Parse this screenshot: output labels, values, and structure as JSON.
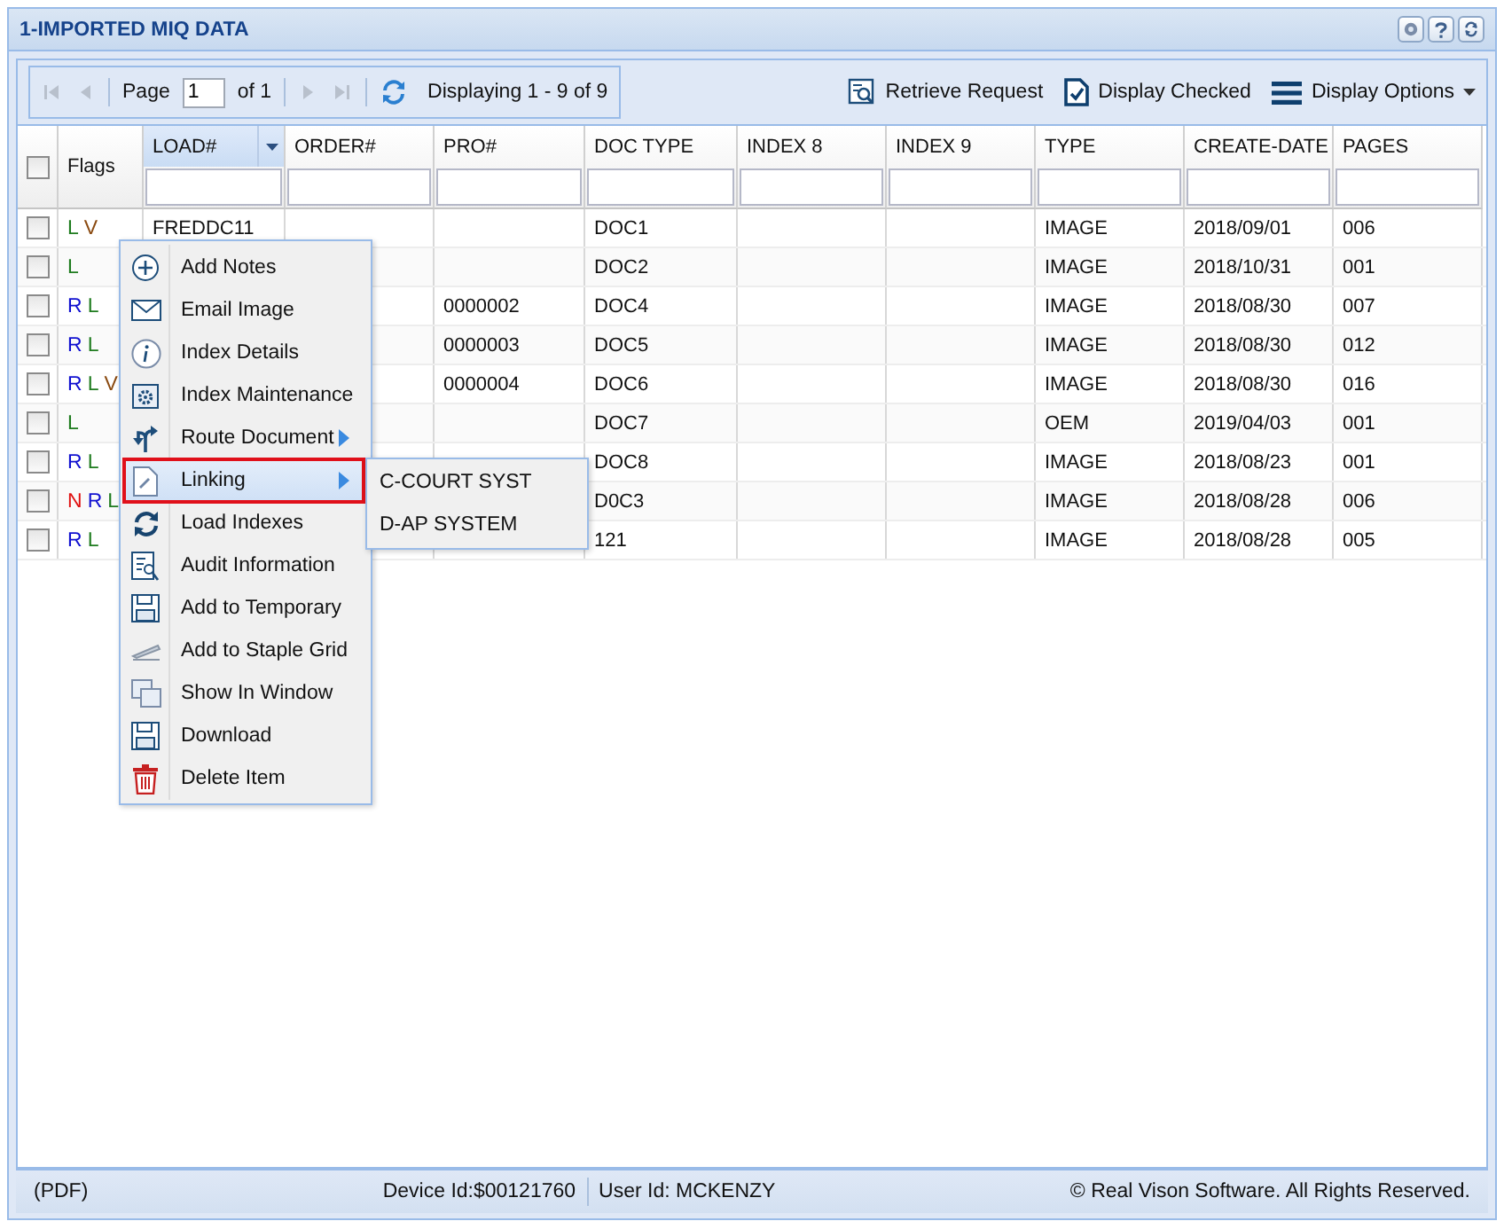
{
  "window": {
    "title": "1-IMPORTED MIQ DATA"
  },
  "tool_buttons": [
    {
      "kind": "gear"
    },
    {
      "kind": "help"
    },
    {
      "kind": "refresh"
    }
  ],
  "pager": {
    "page_label": "Page",
    "page_value": "1",
    "of_label": "of 1",
    "display_text": "Displaying 1 - 9 of 9"
  },
  "actions": [
    {
      "kind": "retrieve",
      "label": "Retrieve Request"
    },
    {
      "kind": "checked",
      "label": "Display Checked"
    },
    {
      "kind": "options",
      "label": "Display Options"
    }
  ],
  "table": {
    "select_all_checked": false,
    "flags_header": "Flags",
    "columns": [
      {
        "label": "LOAD#",
        "selected": true
      },
      {
        "label": "ORDER#",
        "selected": false
      },
      {
        "label": "PRO#",
        "selected": false
      },
      {
        "label": "DOC TYPE",
        "selected": false
      },
      {
        "label": "INDEX 8",
        "selected": false
      },
      {
        "label": "INDEX 9",
        "selected": false
      },
      {
        "label": "TYPE",
        "selected": false
      },
      {
        "label": "CREATE-DATE",
        "selected": false
      },
      {
        "label": "PAGES",
        "selected": false
      }
    ],
    "rows": [
      {
        "checked": false,
        "flags": [
          {
            "text": "L",
            "color": "#1e7b1e"
          },
          {
            "text": "V",
            "color": "#8a4a10"
          }
        ],
        "cells": [
          "FREDDC11",
          "",
          "",
          "DOC1",
          "",
          "",
          "IMAGE",
          "2018/09/01",
          "006"
        ]
      },
      {
        "checked": false,
        "flags": [
          {
            "text": "L",
            "color": "#1e7b1e"
          }
        ],
        "cells": [
          "",
          "",
          "",
          "DOC2",
          "",
          "",
          "IMAGE",
          "2018/10/31",
          "001"
        ]
      },
      {
        "checked": false,
        "flags": [
          {
            "text": "R",
            "color": "#1010d0"
          },
          {
            "text": "L",
            "color": "#1e7b1e"
          }
        ],
        "cells": [
          "",
          "",
          "0000002",
          "DOC4",
          "",
          "",
          "IMAGE",
          "2018/08/30",
          "007"
        ]
      },
      {
        "checked": false,
        "flags": [
          {
            "text": "R",
            "color": "#1010d0"
          },
          {
            "text": "L",
            "color": "#1e7b1e"
          }
        ],
        "cells": [
          "",
          "",
          "0000003",
          "DOC5",
          "",
          "",
          "IMAGE",
          "2018/08/30",
          "012"
        ]
      },
      {
        "checked": false,
        "flags": [
          {
            "text": "R",
            "color": "#1010d0"
          },
          {
            "text": "L",
            "color": "#1e7b1e"
          },
          {
            "text": "V",
            "color": "#8a4a10"
          }
        ],
        "cells": [
          "",
          "",
          "0000004",
          "DOC6",
          "",
          "",
          "IMAGE",
          "2018/08/30",
          "016"
        ]
      },
      {
        "checked": false,
        "flags": [
          {
            "text": "L",
            "color": "#1e7b1e"
          }
        ],
        "cells": [
          "",
          "",
          "",
          "DOC7",
          "",
          "",
          "OEM",
          "2019/04/03",
          "001"
        ]
      },
      {
        "checked": false,
        "flags": [
          {
            "text": "R",
            "color": "#1010d0"
          },
          {
            "text": "L",
            "color": "#1e7b1e"
          }
        ],
        "cells": [
          "",
          "",
          "",
          "DOC8",
          "",
          "",
          "IMAGE",
          "2018/08/23",
          "001"
        ]
      },
      {
        "checked": false,
        "flags": [
          {
            "text": "N",
            "color": "#e01010"
          },
          {
            "text": "R",
            "color": "#1010d0"
          },
          {
            "text": "L",
            "color": "#1e7b1e"
          }
        ],
        "cells": [
          "",
          "",
          "",
          "D0C3",
          "",
          "",
          "IMAGE",
          "2018/08/28",
          "006"
        ]
      },
      {
        "checked": false,
        "flags": [
          {
            "text": "R",
            "color": "#1010d0"
          },
          {
            "text": "L",
            "color": "#1e7b1e"
          }
        ],
        "cells": [
          "",
          "",
          "",
          "121",
          "",
          "",
          "IMAGE",
          "2018/08/28",
          "005"
        ]
      }
    ]
  },
  "context_menu": {
    "items": [
      {
        "kind": "add",
        "label": "Add Notes",
        "submenu": false,
        "selected": false
      },
      {
        "kind": "mail",
        "label": "Email Image",
        "submenu": false,
        "selected": false
      },
      {
        "kind": "info",
        "label": "Index Details",
        "submenu": false,
        "selected": false
      },
      {
        "kind": "gearfile",
        "label": "Index Maintenance",
        "submenu": false,
        "selected": false
      },
      {
        "kind": "route",
        "label": "Route Document",
        "submenu": true,
        "selected": false
      },
      {
        "kind": "link",
        "label": "Linking",
        "submenu": true,
        "selected": true
      },
      {
        "kind": "reload",
        "label": "Load Indexes",
        "submenu": false,
        "selected": false
      },
      {
        "kind": "audit",
        "label": "Audit Information",
        "submenu": false,
        "selected": false
      },
      {
        "kind": "save",
        "label": "Add to Temporary",
        "submenu": false,
        "selected": false
      },
      {
        "kind": "staple",
        "label": "Add to Staple Grid",
        "submenu": false,
        "selected": false
      },
      {
        "kind": "windows",
        "label": "Show In Window",
        "submenu": false,
        "selected": false
      },
      {
        "kind": "save",
        "label": "Download",
        "submenu": false,
        "selected": false
      },
      {
        "kind": "trash",
        "label": "Delete Item",
        "submenu": false,
        "selected": false
      }
    ],
    "submenu": [
      "C-COURT SYST",
      "D-AP SYSTEM"
    ]
  },
  "status_bar": {
    "left": "(PDF)",
    "device": "Device Id:$00121760",
    "user": "User Id: MCKENZY",
    "copyright": "© Real Vison Software. All Rights Reserved."
  }
}
